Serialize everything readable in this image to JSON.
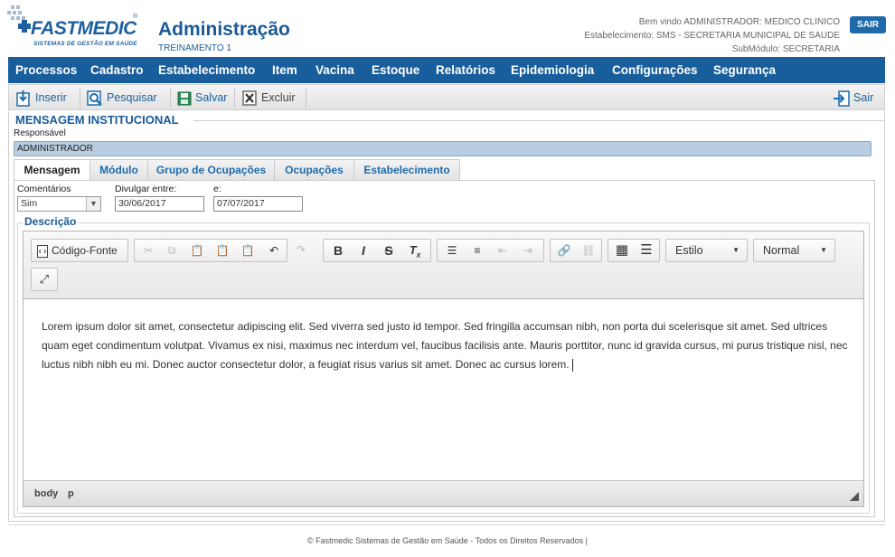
{
  "header": {
    "logo_brand": "FASTMEDIC",
    "logo_tagline": "SISTEMAS DE GESTÃO EM SAÚDE",
    "logo_reg": "®",
    "title": "Administração",
    "subtitle": "TREINAMENTO 1",
    "welcome": "Bem vindo ADMINISTRADOR: MEDICO CLINICO",
    "establishment": "Estabelecimento: SMS - SECRETARIA MUNICIPAL DE SAUDE",
    "submodule": "SubMódulo: SECRETARIA",
    "logout_label": "SAIR"
  },
  "menu": [
    "Processos",
    "Cadastro",
    "Estabelecimento",
    "Item",
    "Vacina",
    "Estoque",
    "Relatórios",
    "Epidemiologia",
    "Configurações",
    "Segurança"
  ],
  "toolbar": {
    "insert": "Inserir",
    "search": "Pesquisar",
    "save": "Salvar",
    "delete": "Excluir",
    "exit": "Sair"
  },
  "section": {
    "title": "MENSAGEM INSTITUCIONAL",
    "responsible_label": "Responsável",
    "responsible_value": "ADMINISTRADOR"
  },
  "tabs": [
    "Mensagem",
    "Módulo",
    "Grupo de Ocupações",
    "Ocupações",
    "Estabelecimento"
  ],
  "form": {
    "comments_label": "Comentários",
    "comments_value": "Sim",
    "divulgar_label": "Divulgar entre:",
    "date_start": "30/06/2017",
    "e_label": "e:",
    "date_end": "07/07/2017",
    "description_label": "Descrição"
  },
  "editor": {
    "source_label": "Código-Fonte",
    "style_label": "Estilo",
    "format_label": "Normal",
    "content": "Lorem ipsum dolor sit amet, consectetur adipiscing elit. Sed viverra sed justo id tempor. Sed fringilla accumsan nibh, non porta dui scelerisque sit amet. Sed ultrices quam eget condimentum volutpat. Vivamus ex nisi, maximus nec interdum vel, faucibus facilisis ante. Mauris porttitor, nunc id gravida cursus, mi purus tristique nisl, nec luctus nibh nibh eu mi. Donec auctor consectetur dolor, a feugiat risus varius sit amet. Donec ac cursus lorem.",
    "path_body": "body",
    "path_p": "p",
    "bold": "B",
    "italic": "I",
    "strike": "S"
  },
  "footer": {
    "text": "© Fastmedic Sistemas de Gestão em Saúde - Todos os Direitos Reservados |"
  },
  "colors": {
    "primary": "#185e9c",
    "title_blue": "#1a5a96",
    "link_blue": "#1f6baa",
    "responsible_bg": "#b9cde0"
  }
}
